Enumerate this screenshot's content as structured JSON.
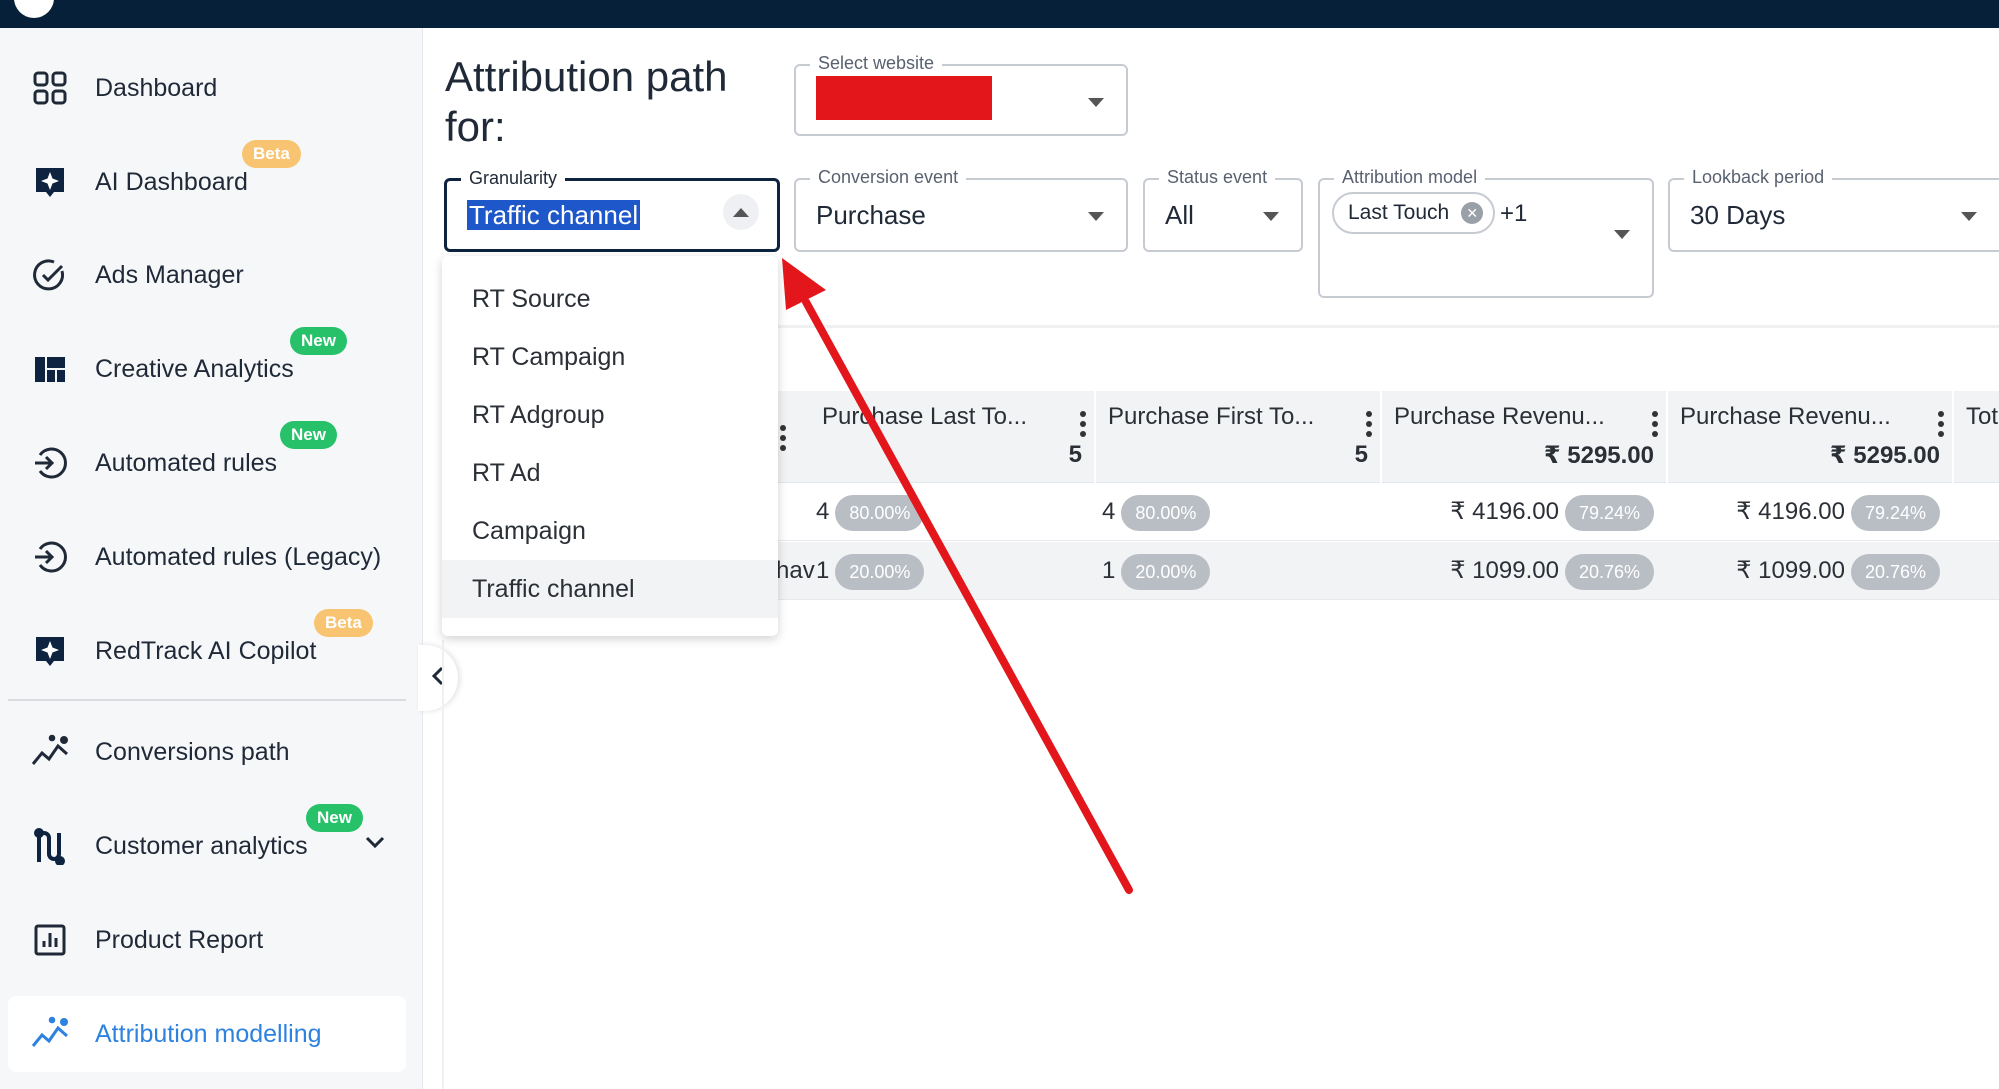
{
  "sidebar": {
    "items": [
      {
        "label": "Dashboard",
        "icon": "grid-icon"
      },
      {
        "label": "AI Dashboard",
        "icon": "sparkle-icon",
        "badge": "Beta"
      },
      {
        "label": "Ads Manager",
        "icon": "ads-manager-icon"
      },
      {
        "label": "Creative Analytics",
        "icon": "layout-icon",
        "badge": "New"
      },
      {
        "label": "Automated rules",
        "icon": "rules-icon",
        "badge": "New"
      },
      {
        "label": "Automated rules (Legacy)",
        "icon": "rules-icon"
      },
      {
        "label": "RedTrack AI Copilot",
        "icon": "sparkle-icon",
        "badge": "Beta"
      },
      {
        "label": "Conversions path",
        "icon": "path-icon"
      },
      {
        "label": "Customer analytics",
        "icon": "customer-icon",
        "badge": "New"
      },
      {
        "label": "Product Report",
        "icon": "report-icon"
      },
      {
        "label": "Attribution modelling",
        "icon": "path-icon"
      }
    ],
    "active_index": 10
  },
  "page": {
    "title": "Attribution path for:"
  },
  "filters": {
    "website": {
      "label": "Select website",
      "value": ""
    },
    "granularity": {
      "label": "Granularity",
      "value": "Traffic channel"
    },
    "conversion_event": {
      "label": "Conversion event",
      "value": "Purchase"
    },
    "status_event": {
      "label": "Status event",
      "value": "All"
    },
    "attribution_model": {
      "label": "Attribution model",
      "chip": "Last Touch",
      "extra": "+1"
    },
    "lookback": {
      "label": "Lookback period",
      "value": "30 Days"
    }
  },
  "granularity_options": [
    "RT Source",
    "RT Campaign",
    "RT Adgroup",
    "RT Ad",
    "Campaign",
    "Traffic channel"
  ],
  "table": {
    "columns": [
      {
        "title": "Purchase Last To...",
        "total": "5"
      },
      {
        "title": "Purchase First To...",
        "total": "5"
      },
      {
        "title": "Purchase Revenu...",
        "total": "₹ 5295.00"
      },
      {
        "title": "Purchase Revenu...",
        "total": "₹ 5295.00"
      },
      {
        "title": "Tota",
        "total": ""
      }
    ],
    "rows": [
      {
        "lead": "",
        "c1": "4",
        "c1p": "80.00%",
        "c2": "4",
        "c2p": "80.00%",
        "c3": "₹ 4196.00",
        "c3p": "79.24%",
        "c4": "₹ 4196.00",
        "c4p": "79.24%"
      },
      {
        "lead": "hav",
        "c1": "1",
        "c1p": "20.00%",
        "c2": "1",
        "c2p": "20.00%",
        "c3": "₹ 1099.00",
        "c3p": "20.76%",
        "c4": "₹ 1099.00",
        "c4p": "20.76%"
      }
    ]
  },
  "colors": {
    "accent": "#2d82e0",
    "topbar": "#06203a",
    "annotation_arrow": "#e3161b",
    "badge_new": "#27c16a",
    "badge_beta": "#f8c471"
  }
}
